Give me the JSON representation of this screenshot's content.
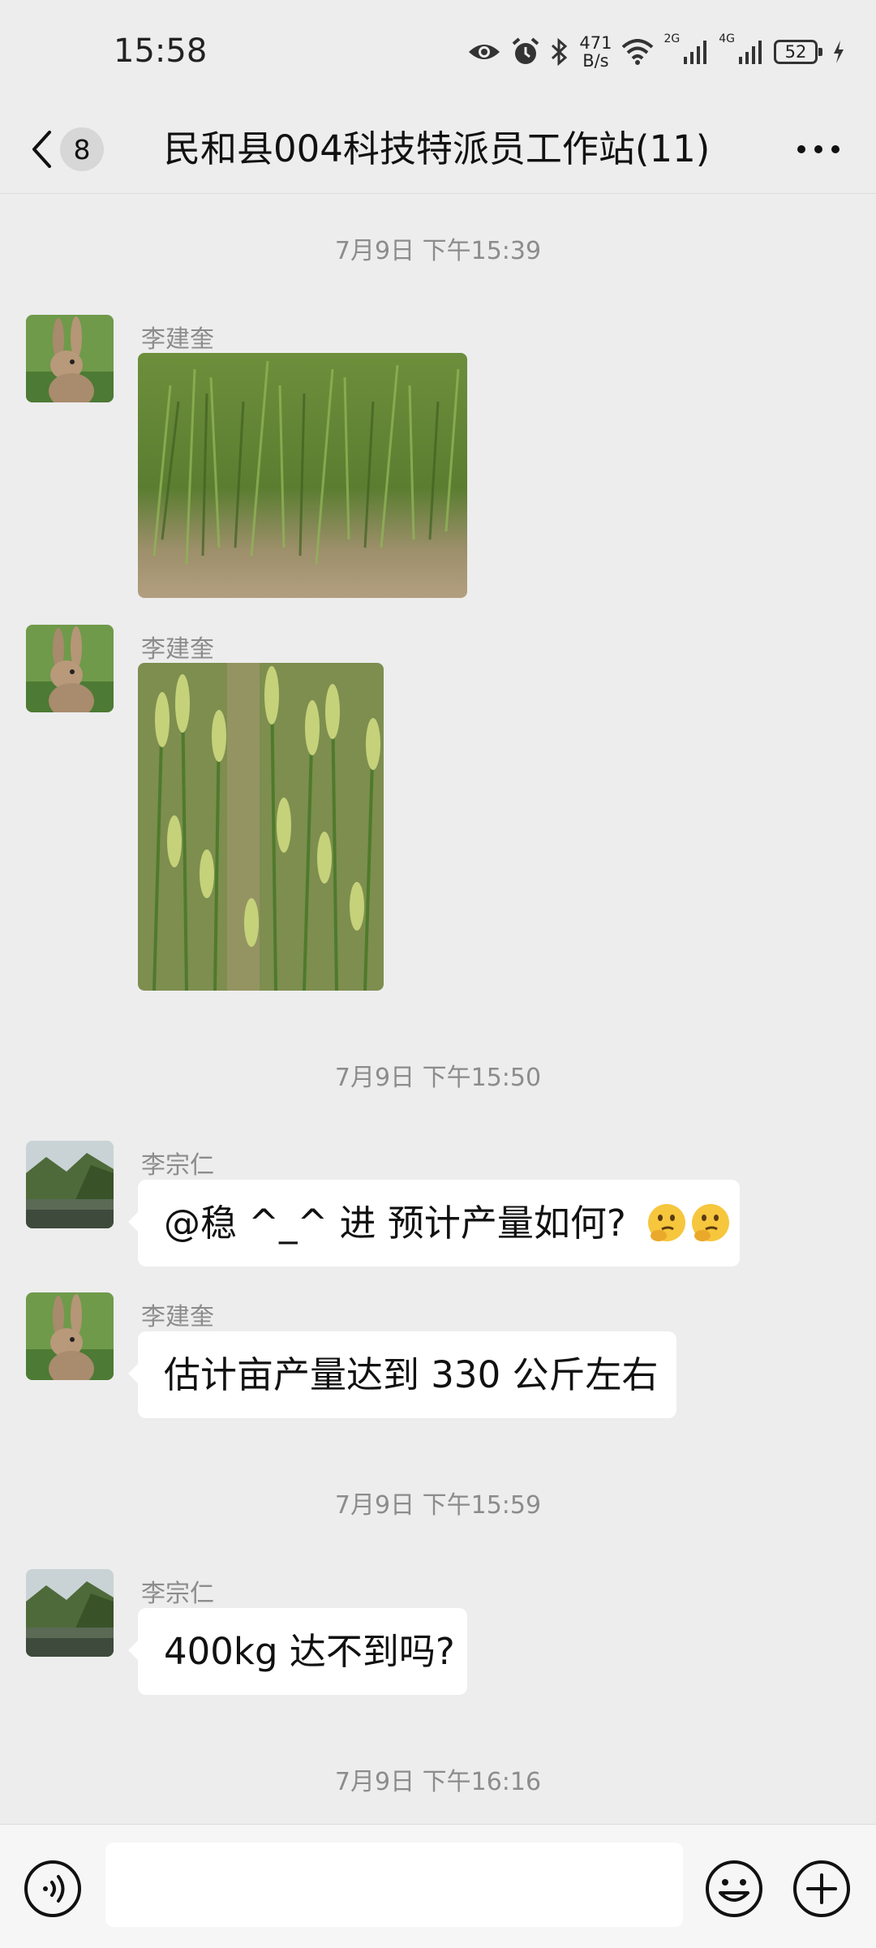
{
  "status_bar": {
    "time": "15:58",
    "speed_value": "471",
    "speed_unit": "B/s",
    "net_2g": "2G",
    "net_4g": "4G",
    "battery": "52"
  },
  "header": {
    "unread_count": "8",
    "title": "民和县004科技特派员工作站(11)"
  },
  "messages": {
    "ts1": "7月9日 下午15:39",
    "m1_sender": "李建奎",
    "m2_sender": "李建奎",
    "ts2": "7月9日 下午15:50",
    "m3_sender": "李宗仁",
    "m3_text": "@稳 ^_^ 进  预计产量如何?",
    "m4_sender": "李建奎",
    "m4_text": "估计亩产量达到 330 公斤左右",
    "ts3": "7月9日 下午15:59",
    "m5_sender": "李宗仁",
    "m5_text": "400kg 达不到吗?",
    "ts4": "7月9日 下午16:16"
  },
  "input": {
    "placeholder": ""
  },
  "icons": {
    "eye": "eye-icon",
    "alarm": "alarm-icon",
    "bluetooth": "bluetooth-icon",
    "wifi": "wifi-icon",
    "signal": "signal-icon",
    "charging": "charging-icon",
    "back": "chevron-left-icon",
    "more": "more-icon",
    "voice": "voice-icon",
    "emoji": "emoji-icon",
    "plus": "plus-icon",
    "thinking": "thinking-face-icon"
  },
  "colors": {
    "background": "#ededed",
    "bubble": "#ffffff",
    "timestamp": "#8c8c8c"
  }
}
